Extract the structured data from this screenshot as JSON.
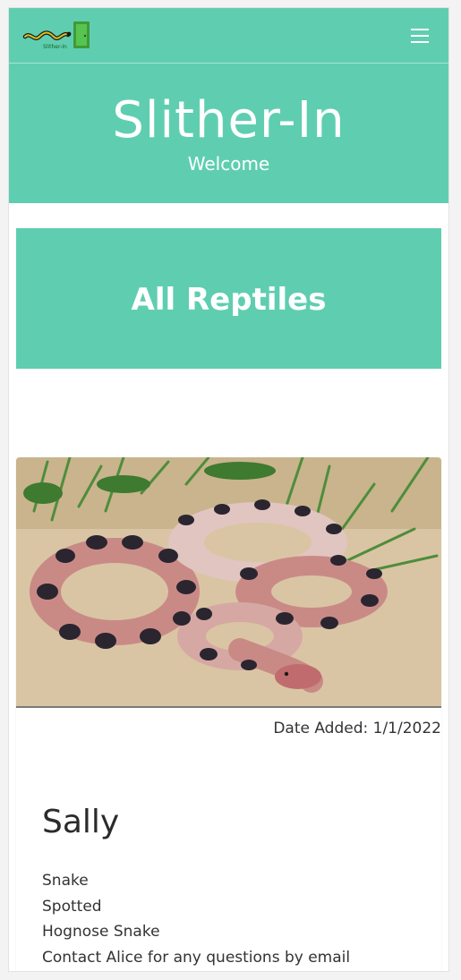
{
  "app": {
    "logo_text": "Slither-In",
    "title": "Slither-In",
    "subtitle": "Welcome"
  },
  "section": {
    "heading": "All Reptiles"
  },
  "listing": {
    "date_added": "Date Added: 1/1/2022",
    "name": "Sally",
    "details": [
      "Snake",
      "Spotted",
      "Hognose Snake",
      "Contact Alice for any questions by email"
    ]
  },
  "colors": {
    "brand_green": "#5fceb0",
    "text": "#333333"
  },
  "icons": {
    "menu": "hamburger-menu-icon",
    "logo": "snake-door-logo"
  }
}
